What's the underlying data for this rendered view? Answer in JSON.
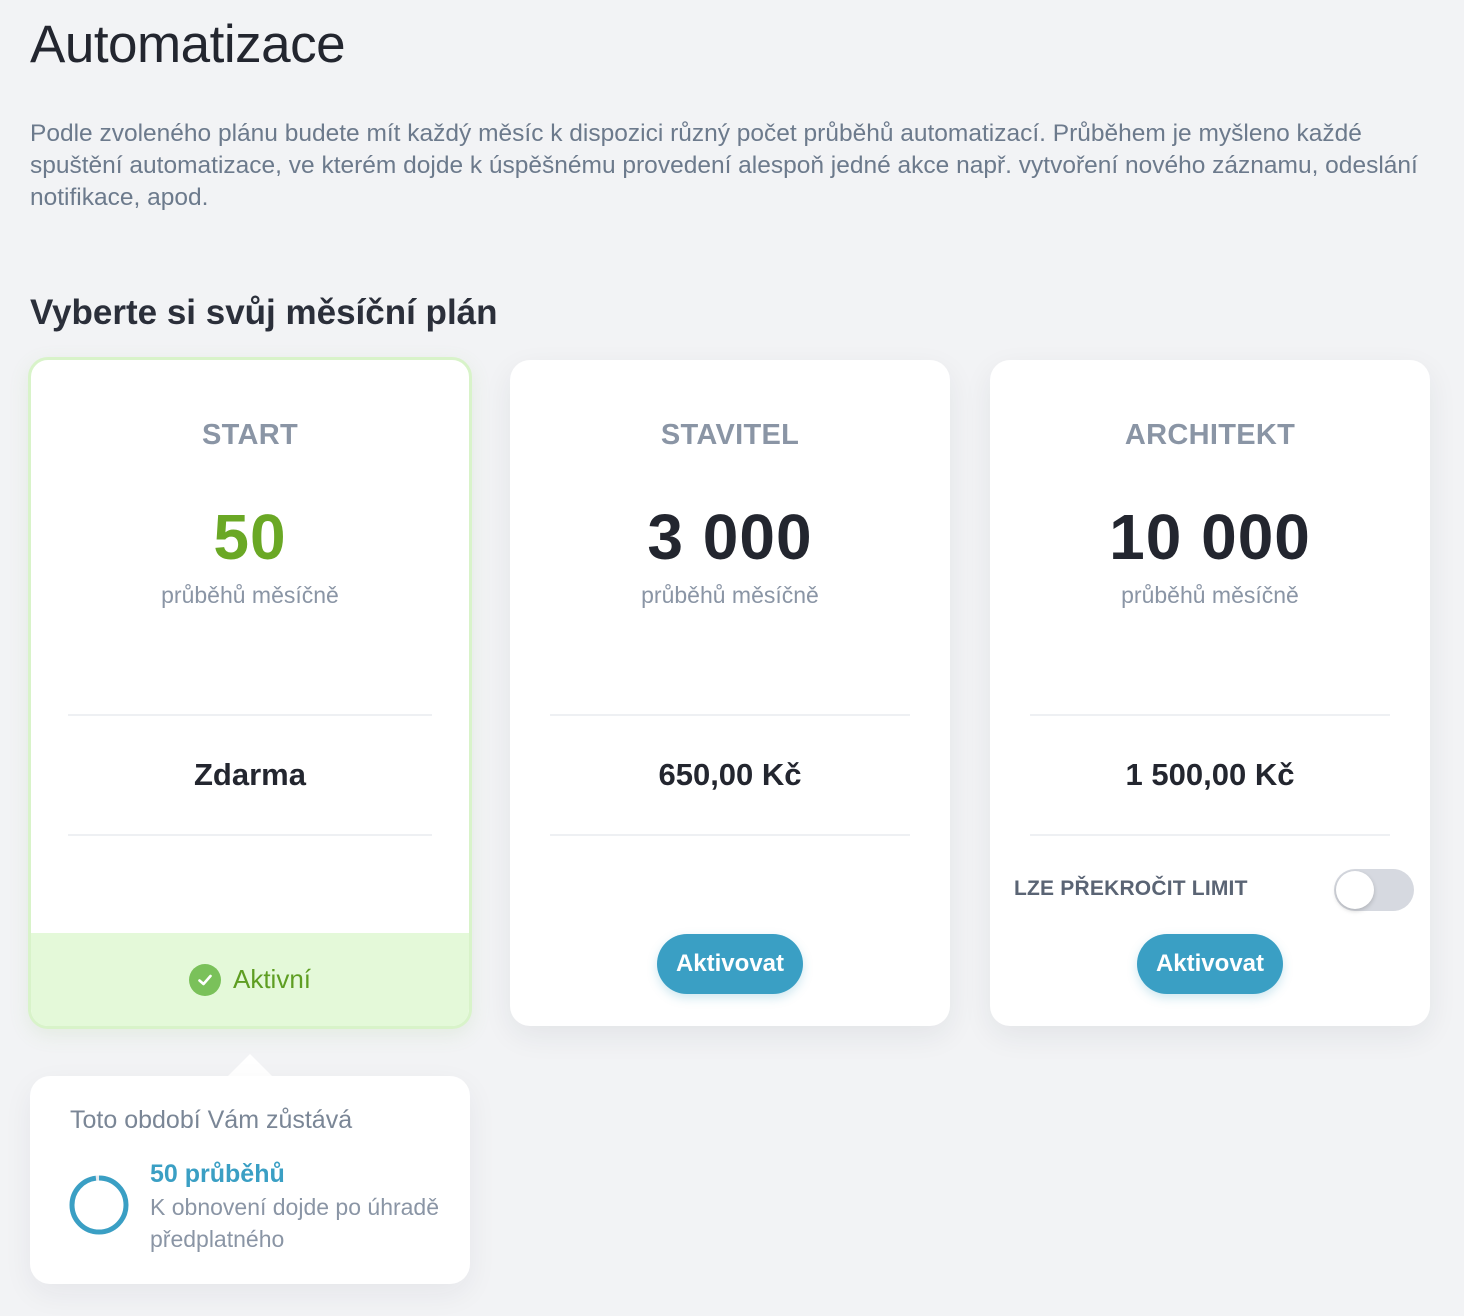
{
  "page": {
    "title": "Automatizace",
    "intro": "Podle zvoleného plánu budete mít každý měsíc k dispozici různý počet průběhů automatizací. Průběhem je myšleno každé spuštění automatizace, ve kterém dojde k úspěšnému provedení alespoň jedné akce např. vytvoření nového záznamu, odeslání notifikace, apod.",
    "subtitle": "Vyberte si svůj měsíční plán"
  },
  "plans": [
    {
      "name": "START",
      "count": "50",
      "unit": "průběhů měsíčně",
      "price": "Zdarma",
      "status": "Aktivní",
      "active": true
    },
    {
      "name": "STAVITEL",
      "count": "3 000",
      "unit": "průběhů měsíčně",
      "price": "650,00 Kč",
      "button": "Aktivovat",
      "active": false
    },
    {
      "name": "ARCHITEKT",
      "count": "10 000",
      "unit": "průběhů měsíčně",
      "price": "1 500,00 Kč",
      "overrun_label": "LZE PŘEKROČIT LIMIT",
      "overrun_enabled": false,
      "button": "Aktivovat",
      "active": false
    }
  ],
  "remaining": {
    "title": "Toto období Vám zůstává",
    "count": "50 průběhů",
    "note": "K obnovení dojde po úhradě předplatného",
    "progress": 0.98
  },
  "colors": {
    "accent": "#3a9fc4",
    "active_green": "#6aa825",
    "active_bg": "#e4f9d9",
    "background": "#f2f3f5"
  }
}
